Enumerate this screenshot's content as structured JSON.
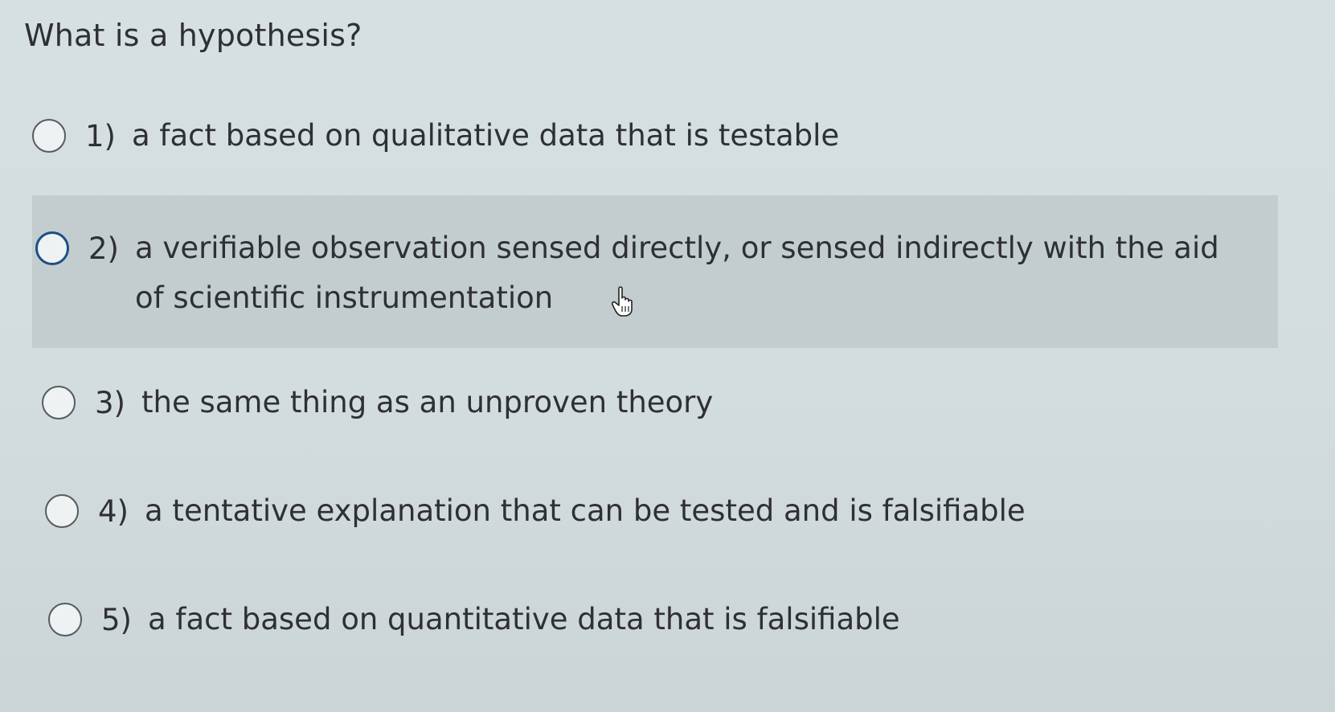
{
  "question": {
    "title": "What is a hypothesis?"
  },
  "options": [
    {
      "number": "1)",
      "label": "a fact based on qualitative data that is testable",
      "selected": false,
      "hovered": false
    },
    {
      "number": "2)",
      "label": "a verifiable observation sensed directly, or sensed indirectly with the aid of scientific instrumentation",
      "selected": false,
      "hovered": true
    },
    {
      "number": "3)",
      "label": "the same thing as an unproven theory",
      "selected": false,
      "hovered": false
    },
    {
      "number": "4)",
      "label": "a tentative explanation that can be tested and is falsifiable",
      "selected": false,
      "hovered": false
    },
    {
      "number": "5)",
      "label": "a fact based on quantitative data that is falsifiable",
      "selected": false,
      "hovered": false
    }
  ],
  "colors": {
    "background": "#d6e0e2",
    "hover_highlight": "#c3cdcf",
    "hover_radio_border": "#1d4f87",
    "text": "#2f3033"
  },
  "icons": {
    "cursor": "hand-pointer-icon",
    "radio": "radio-button-icon"
  }
}
